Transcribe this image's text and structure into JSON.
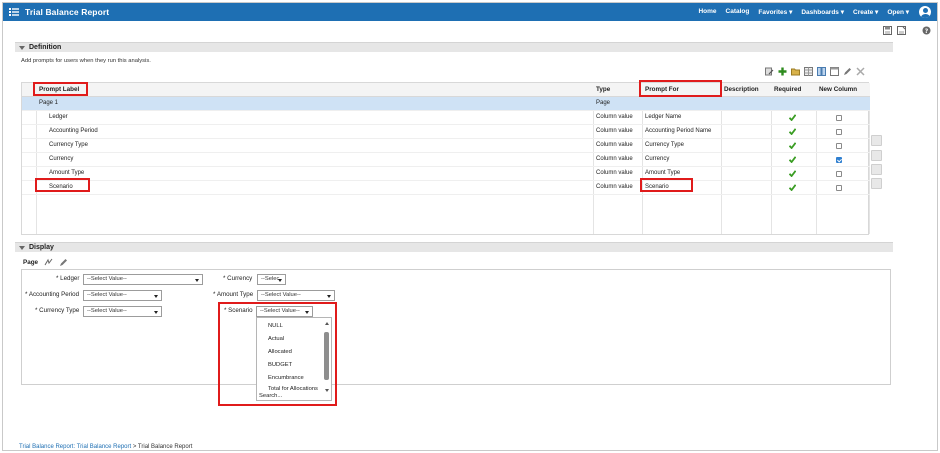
{
  "header": {
    "app_title": "Trial Balance Report",
    "nav": [
      "Home",
      "Catalog",
      "Favorites ▾",
      "Dashboards ▾",
      "Create ▾",
      "Open ▾"
    ]
  },
  "definition": {
    "title": "Definition",
    "hint": "Add prompts for users when they run this analysis.",
    "columns": {
      "label": "Prompt Label",
      "type": "Type",
      "prompt_for": "Prompt For",
      "description": "Description",
      "required": "Required",
      "new_column": "New Column"
    },
    "page_row": {
      "label": "Page 1",
      "type": "Page"
    },
    "rows": [
      {
        "label": "Ledger",
        "type": "Column value",
        "prompt_for": "Ledger Name",
        "required": true,
        "new_column": false
      },
      {
        "label": "Accounting Period",
        "type": "Column value",
        "prompt_for": "Accounting Period Name",
        "required": true,
        "new_column": false
      },
      {
        "label": "Currency Type",
        "type": "Column value",
        "prompt_for": "Currency Type",
        "required": true,
        "new_column": false
      },
      {
        "label": "Currency",
        "type": "Column value",
        "prompt_for": "Currency",
        "required": true,
        "new_column": true
      },
      {
        "label": "Amount Type",
        "type": "Column value",
        "prompt_for": "Amount Type",
        "required": true,
        "new_column": false
      },
      {
        "label": "Scenario",
        "type": "Column value",
        "prompt_for": "Scenario",
        "required": true,
        "new_column": false
      }
    ]
  },
  "display": {
    "title": "Display",
    "tab_label": "Page",
    "fields": {
      "ledger": {
        "label": "Ledger",
        "value": "--Select Value--"
      },
      "accounting_period": {
        "label": "Accounting Period",
        "value": "--Select Value--"
      },
      "currency_type": {
        "label": "Currency Type",
        "value": "--Select Value--"
      },
      "currency": {
        "label": "Currency",
        "value": "--Selec"
      },
      "amount_type": {
        "label": "Amount Type",
        "value": "--Select Value--"
      },
      "scenario": {
        "label": "Scenario",
        "value": "--Select Value--"
      }
    },
    "required_mark": "*",
    "scenario_options": [
      "NULL",
      "Actual",
      "Allocated",
      "BUDGET",
      "Encumbrance",
      "Total for Allocations"
    ],
    "search_label": "Search..."
  },
  "breadcrumb": {
    "link": "Trial Balance Report: Trial Balance Report",
    "separator": ">",
    "current": "Trial Balance Report"
  },
  "colors": {
    "topbar": "#1e6fb3",
    "highlight": "#e01b1b",
    "page_row": "#cfe2f5",
    "check": "#3a9d23"
  }
}
